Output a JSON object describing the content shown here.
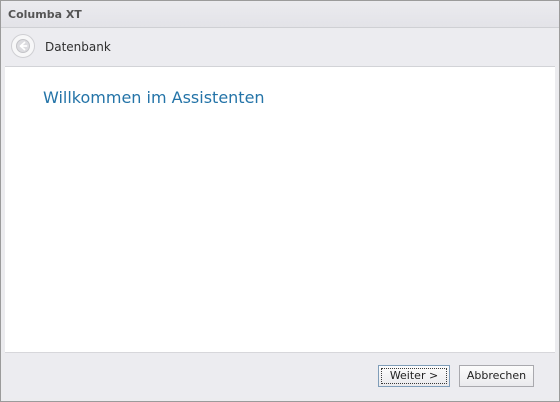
{
  "window": {
    "title": "Columba XT"
  },
  "header": {
    "title": "Datenbank",
    "back_icon": "back-arrow-icon"
  },
  "content": {
    "heading": "Willkommen im Assistenten",
    "heading_color": "#2474a8"
  },
  "footer": {
    "next_label": "Weiter >",
    "cancel_label": "Abbrechen"
  }
}
